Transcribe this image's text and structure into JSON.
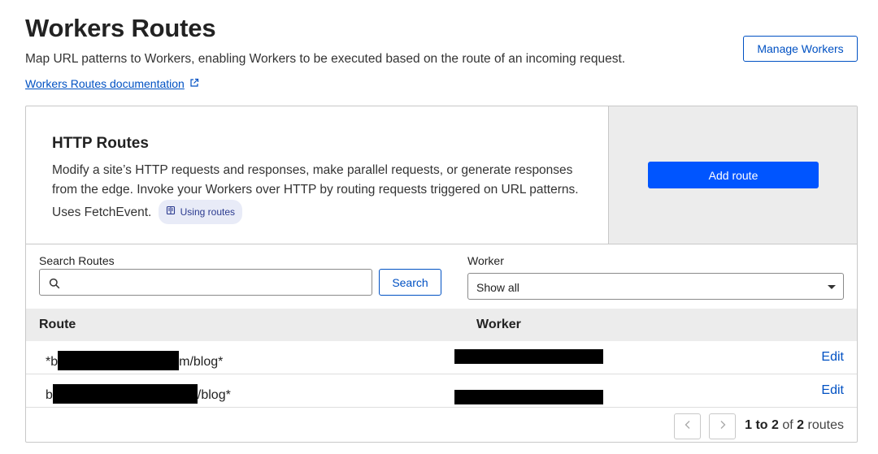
{
  "header": {
    "title": "Workers Routes",
    "subtitle": "Map URL patterns to Workers, enabling Workers to be executed based on the route of an incoming request.",
    "doc_link": "Workers Routes documentation",
    "manage_button": "Manage Workers"
  },
  "http_routes": {
    "title": "HTTP Routes",
    "description": "Modify a site’s HTTP requests and responses, make parallel requests, or generate responses from the edge. Invoke your Workers over HTTP by routing requests triggered on URL patterns. Uses FetchEvent.",
    "pill_label": "Using routes",
    "add_button": "Add route"
  },
  "filters": {
    "search_label": "Search Routes",
    "search_value": "",
    "search_button": "Search",
    "worker_label": "Worker",
    "worker_value": "Show all"
  },
  "table": {
    "columns": [
      "Route",
      "Worker"
    ],
    "rows": [
      {
        "route_prefix": "*b",
        "route_suffix": "m/blog*",
        "edit": "Edit"
      },
      {
        "route_prefix": "b",
        "route_suffix": "/blog*",
        "edit": "Edit"
      }
    ]
  },
  "pagination": {
    "from": "1",
    "to_word": "to",
    "to": "2",
    "of_word": "of",
    "total": "2",
    "unit": "routes"
  },
  "colors": {
    "primary": "#0055ff",
    "link": "#0051c3"
  }
}
